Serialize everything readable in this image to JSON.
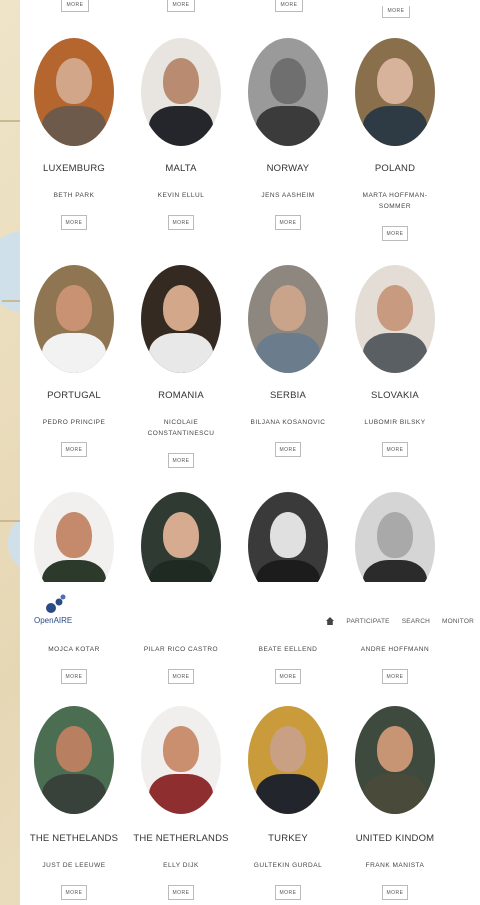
{
  "top_row": {
    "more_label": "MORE"
  },
  "nav": {
    "logo_text": "OpenAIRE",
    "links": [
      "PARTICIPATE",
      "SEARCH",
      "MONITOR"
    ]
  },
  "rows": [
    [
      {
        "country": "LUXEMBURG",
        "name": "BETH PARK",
        "more": "MORE"
      },
      {
        "country": "MALTA",
        "name": "KEVIN ELLUL",
        "more": "MORE"
      },
      {
        "country": "NORWAY",
        "name": "JENS AASHEIM",
        "more": "MORE"
      },
      {
        "country": "POLAND",
        "name": "MARTA HOFFMAN-SOMMER",
        "more": "MORE"
      }
    ],
    [
      {
        "country": "PORTUGAL",
        "name": "PEDRO PRINCIPE",
        "more": "MORE"
      },
      {
        "country": "ROMANIA",
        "name": "NICOLAIE CONSTANTINESCU",
        "more": "MORE"
      },
      {
        "country": "SERBIA",
        "name": "BILJANA KOSANOVIC",
        "more": "MORE"
      },
      {
        "country": "SLOVAKIA",
        "name": "LUBOMIR BILSKY",
        "more": "MORE"
      }
    ],
    [
      {
        "country": "",
        "name": "MOJCA KOTAR",
        "more": "MORE"
      },
      {
        "country": "",
        "name": "PILAR RICO CASTRO",
        "more": "MORE"
      },
      {
        "country": "",
        "name": "BEATE EELLEND",
        "more": "MORE"
      },
      {
        "country": "",
        "name": "ANDRE HOFFMANN",
        "more": "MORE"
      }
    ],
    [
      {
        "country": "THE NETHELANDS",
        "name": "JUST DE LEEUWE",
        "more": "MORE"
      },
      {
        "country": "THE NETHERLANDS",
        "name": "ELLY DIJK",
        "more": "MORE"
      },
      {
        "country": "TURKEY",
        "name": "GULTEKIN GURDAL",
        "more": "MORE"
      },
      {
        "country": "UNITED KINDOM",
        "name": "FRANK MANISTA",
        "more": "MORE"
      }
    ]
  ],
  "colors": {
    "nav_logo": "#2b4b86",
    "border": "#bbbbbb"
  }
}
